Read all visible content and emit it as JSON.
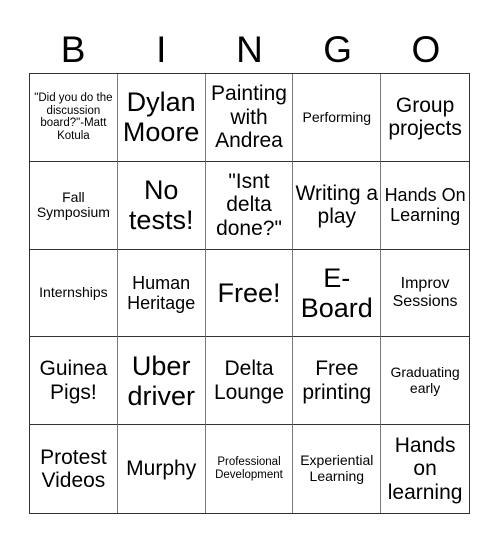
{
  "header": {
    "letters": [
      "B",
      "I",
      "N",
      "G",
      "O"
    ]
  },
  "card": {
    "cells": [
      {
        "text": "\"Did you do the discussion board?\"-Matt Kotula",
        "size": "s-xs"
      },
      {
        "text": "Dylan Moore",
        "size": "s-xl"
      },
      {
        "text": "Painting with Andrea",
        "size": "s-l"
      },
      {
        "text": "Performing",
        "size": "s-s"
      },
      {
        "text": "Group projects",
        "size": "s-l"
      },
      {
        "text": "Fall Symposium",
        "size": "s-s"
      },
      {
        "text": "No tests!",
        "size": "s-xl"
      },
      {
        "text": "\"Isnt delta done?\"",
        "size": "s-l"
      },
      {
        "text": "Writing a play",
        "size": "s-l"
      },
      {
        "text": "Hands On Learning",
        "size": "s-m"
      },
      {
        "text": "Internships",
        "size": "s-s"
      },
      {
        "text": "Human Heritage",
        "size": "s-m"
      },
      {
        "text": "Free!",
        "size": "s-xl"
      },
      {
        "text": "E-Board",
        "size": "s-xl"
      },
      {
        "text": "Improv Sessions",
        "size": "s-ms"
      },
      {
        "text": "Guinea Pigs!",
        "size": "s-l"
      },
      {
        "text": "Uber driver",
        "size": "s-xl"
      },
      {
        "text": "Delta Lounge",
        "size": "s-l"
      },
      {
        "text": "Free printing",
        "size": "s-l"
      },
      {
        "text": "Graduating early",
        "size": "s-s"
      },
      {
        "text": "Protest Videos",
        "size": "s-l"
      },
      {
        "text": "Murphy",
        "size": "s-l"
      },
      {
        "text": "Professional Development",
        "size": "s-xs"
      },
      {
        "text": "Experiential Learning",
        "size": "s-s"
      },
      {
        "text": "Hands on learning",
        "size": "s-l"
      }
    ]
  }
}
